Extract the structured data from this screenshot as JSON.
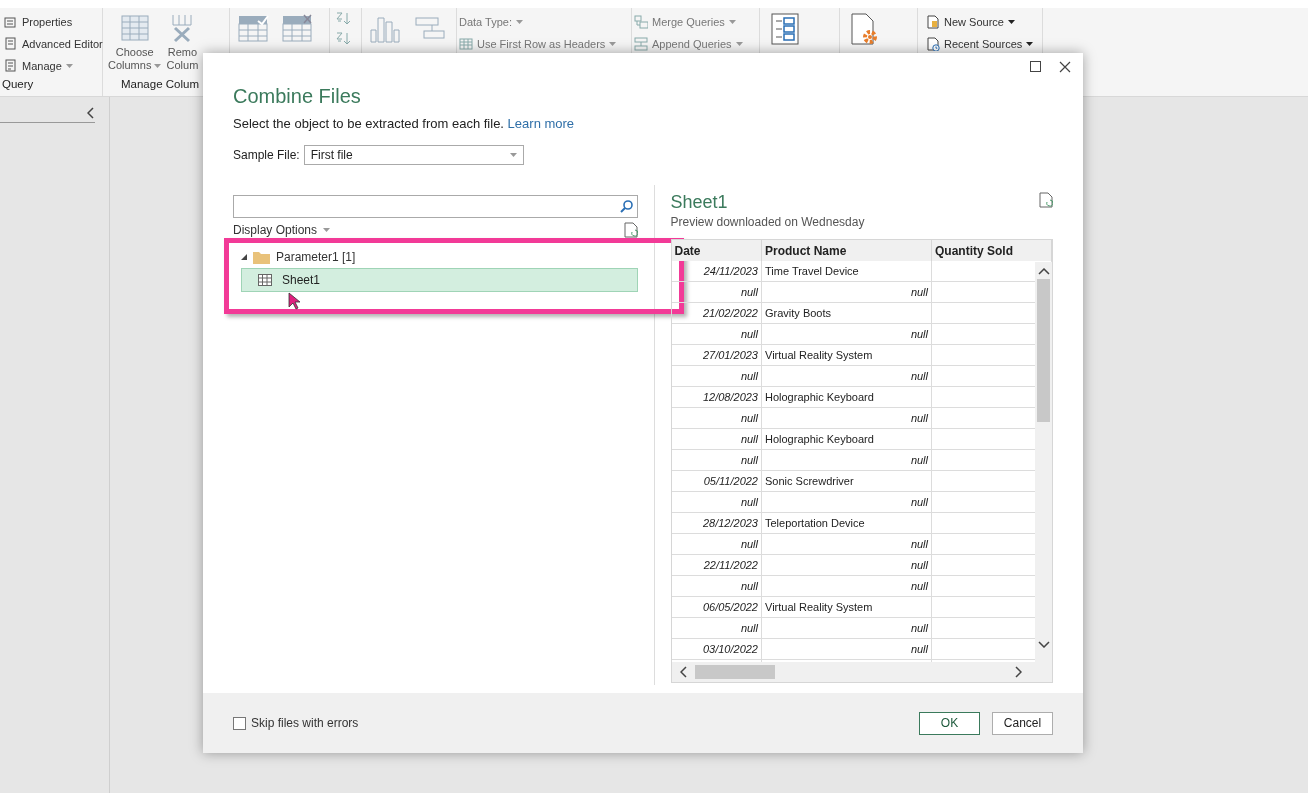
{
  "ribbon": {
    "groups": [
      {
        "kind": "stack",
        "label": "Query",
        "items": [
          {
            "label": "Properties",
            "dropdown": false,
            "disabled": false
          },
          {
            "label": "Advanced Editor",
            "dropdown": false,
            "disabled": false
          },
          {
            "label": "Manage",
            "dropdown": true,
            "disabled": false
          }
        ]
      },
      {
        "kind": "large",
        "label": "Manage Colum",
        "items": [
          {
            "lines": [
              "Choose",
              "Columns"
            ],
            "dropdown": true
          },
          {
            "lines": [
              "Remo",
              "Colum"
            ],
            "dropdown": false
          }
        ]
      },
      {
        "kind": "icons"
      },
      {
        "kind": "icons"
      },
      {
        "kind": "icons"
      },
      {
        "kind": "stack",
        "items": [
          {
            "label": "Data Type:",
            "dropdown": true,
            "disabled": true
          },
          {
            "label": "Use First Row as Headers",
            "dropdown": true,
            "disabled": true
          }
        ]
      },
      {
        "kind": "stack",
        "items": [
          {
            "label": "Merge Queries",
            "dropdown": true,
            "disabled": true
          },
          {
            "label": "Append Queries",
            "dropdown": true,
            "disabled": true
          }
        ]
      },
      {
        "kind": "icons"
      },
      {
        "kind": "icons"
      },
      {
        "kind": "stack",
        "items": [
          {
            "label": "New Source",
            "dropdown": true,
            "disabled": false
          },
          {
            "label": "Recent Sources",
            "dropdown": true,
            "disabled": false
          }
        ]
      }
    ]
  },
  "dialog": {
    "title": "Combine Files",
    "subtitle": "Select the object to be extracted from each file.",
    "link": "Learn more",
    "sample_file": {
      "label": "Sample File:",
      "value": "First file"
    },
    "display_options": "Display Options",
    "tree": [
      {
        "label": "Parameter1 [1]",
        "expanded": true,
        "children": [
          {
            "label": "Sheet1",
            "selected": true
          }
        ]
      }
    ],
    "preview": {
      "title": "Sheet1",
      "subtitle": "Preview downloaded on Wednesday",
      "columns": [
        "Date",
        "Product Name",
        "Quantity Sold"
      ],
      "rows": [
        [
          {
            "kind": "date",
            "text": "24/11/2023"
          },
          {
            "kind": "text",
            "text": "Time Travel Device"
          }
        ],
        [
          {
            "kind": "null",
            "text": "null"
          },
          {
            "kind": "null",
            "text": "null"
          }
        ],
        [
          {
            "kind": "date",
            "text": "21/02/2022"
          },
          {
            "kind": "text",
            "text": "Gravity Boots"
          }
        ],
        [
          {
            "kind": "null",
            "text": "null"
          },
          {
            "kind": "null",
            "text": "null"
          }
        ],
        [
          {
            "kind": "date",
            "text": "27/01/2023"
          },
          {
            "kind": "text",
            "text": "Virtual Reality System"
          }
        ],
        [
          {
            "kind": "null",
            "text": "null"
          },
          {
            "kind": "null",
            "text": "null"
          }
        ],
        [
          {
            "kind": "date",
            "text": "12/08/2023"
          },
          {
            "kind": "text",
            "text": "Holographic Keyboard"
          }
        ],
        [
          {
            "kind": "null",
            "text": "null"
          },
          {
            "kind": "null",
            "text": "null"
          }
        ],
        [
          {
            "kind": "null",
            "text": "null"
          },
          {
            "kind": "text",
            "text": "Holographic Keyboard"
          }
        ],
        [
          {
            "kind": "null",
            "text": "null"
          },
          {
            "kind": "null",
            "text": "null"
          }
        ],
        [
          {
            "kind": "date",
            "text": "05/11/2022"
          },
          {
            "kind": "text",
            "text": "Sonic Screwdriver"
          }
        ],
        [
          {
            "kind": "null",
            "text": "null"
          },
          {
            "kind": "null",
            "text": "null"
          }
        ],
        [
          {
            "kind": "date",
            "text": "28/12/2023"
          },
          {
            "kind": "text",
            "text": "Teleportation Device"
          }
        ],
        [
          {
            "kind": "null",
            "text": "null"
          },
          {
            "kind": "null",
            "text": "null"
          }
        ],
        [
          {
            "kind": "date",
            "text": "22/11/2022"
          },
          {
            "kind": "null",
            "text": "null"
          }
        ],
        [
          {
            "kind": "null",
            "text": "null"
          },
          {
            "kind": "null",
            "text": "null"
          }
        ],
        [
          {
            "kind": "date",
            "text": "06/05/2022"
          },
          {
            "kind": "text",
            "text": "Virtual Reality System"
          }
        ],
        [
          {
            "kind": "null",
            "text": "null"
          },
          {
            "kind": "null",
            "text": "null"
          }
        ],
        [
          {
            "kind": "date",
            "text": "03/10/2022"
          },
          {
            "kind": "null",
            "text": "null"
          }
        ]
      ]
    },
    "skip_errors": {
      "label": "Skip files with errors",
      "checked": false
    },
    "buttons": [
      {
        "label": "OK",
        "kind": "primary"
      },
      {
        "label": "Cancel",
        "kind": "secondary"
      }
    ]
  }
}
